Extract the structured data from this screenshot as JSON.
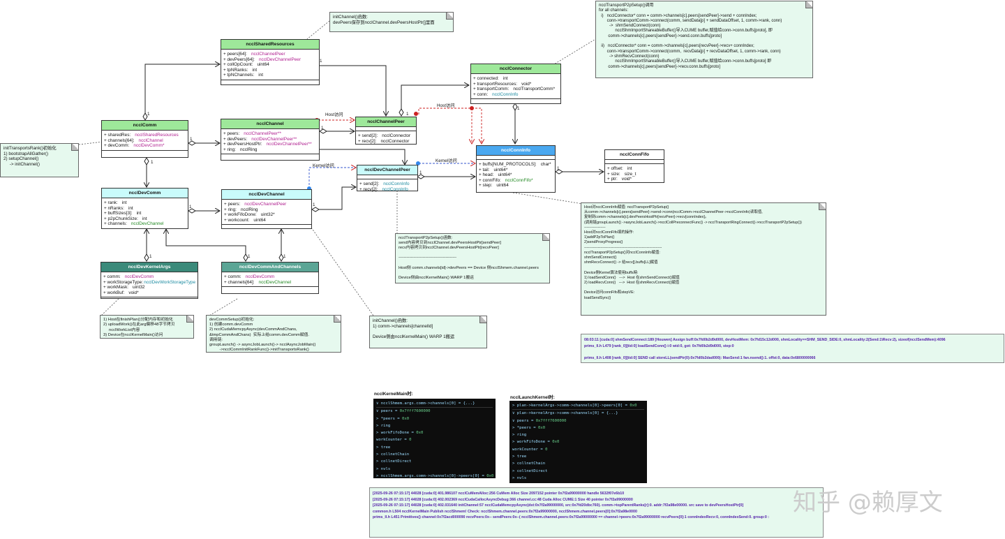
{
  "classes": {
    "sharedResources": {
      "title": "ncclSharedResources",
      "fields": [
        {
          "name": "+ peers[64]:",
          "type": "ncclChannelPeer",
          "tc": "mag"
        },
        {
          "name": "+ devPeers[64]:",
          "type": "ncclDevChannelPeer",
          "tc": "mag"
        },
        {
          "name": "+ collOpCount:",
          "type": "uint64"
        },
        {
          "name": "+ tpNRanks:",
          "type": "int"
        },
        {
          "name": "+ tpNChannels:",
          "type": "int"
        }
      ]
    },
    "comm": {
      "title": "ncclComm",
      "fields": [
        {
          "name": "+ sharedRes:",
          "type": "ncclSharedResources",
          "tc": "mag"
        },
        {
          "name": "+ channels[64]:",
          "type": "ncclChannel",
          "tc": "mag"
        },
        {
          "name": "+ devComm:",
          "type": "ncclDevComm*",
          "tc": "mag"
        }
      ]
    },
    "channel": {
      "title": "ncclChannel",
      "fields": [
        {
          "name": "+ peers:",
          "type": "ncclChannelPeer**",
          "tc": "mag"
        },
        {
          "name": "+ devPeers:",
          "type": "ncclDevChannelPeer**",
          "tc": "mag"
        },
        {
          "name": "+ devPeersHostPtr:",
          "type": "ncclDevChannelPeer**",
          "tc": "mag"
        },
        {
          "name": "+ ring:",
          "type": "ncclRing"
        }
      ]
    },
    "channelPeer": {
      "title": "ncclChannelPeer",
      "fields": [
        {
          "name": "+ send[2]:",
          "type": "ncclConnector"
        },
        {
          "name": "+ recv[2]:",
          "type": "ncclConnector"
        }
      ]
    },
    "connector": {
      "title": "ncclConnector",
      "fields": [
        {
          "name": "+ connected:",
          "type": "int"
        },
        {
          "name": "+ transportResources:",
          "type": "void*"
        },
        {
          "name": "+ transportComm:",
          "type": "ncclTransportComm*"
        },
        {
          "name": "+ conn:",
          "type": "ncclConnInfo",
          "tc": "cy"
        }
      ]
    },
    "connInfo": {
      "title": "ncclConnInfo",
      "fields": [
        {
          "name": "+ buffs[NUM_PROTOCOLS]:",
          "type": "char*"
        },
        {
          "name": "+ tail:",
          "type": "uint64*"
        },
        {
          "name": "+ head:",
          "type": "uint64*"
        },
        {
          "name": "+ connFifo:",
          "type": "ncclConnFifo*",
          "tc": "gr"
        },
        {
          "name": "+ step:",
          "type": "uint64"
        }
      ]
    },
    "connFifo": {
      "title": "ncclConnFifo",
      "fields": [
        {
          "name": "+ offset:",
          "type": "int"
        },
        {
          "name": "+ size:",
          "type": "size_t"
        },
        {
          "name": "+ ptr:",
          "type": "void*"
        }
      ]
    },
    "devChannelPeer": {
      "title": "ncclDevChannelPeer",
      "fields": [
        {
          "name": "+ send[2]:",
          "type": "ncclConnInfo",
          "tc": "cy"
        },
        {
          "name": "+ recv[2]:",
          "type": "ncclConnInfo",
          "tc": "cy"
        }
      ]
    },
    "devComm": {
      "title": "ncclDevComm",
      "fields": [
        {
          "name": "+ rank:",
          "type": "int"
        },
        {
          "name": "+ nRanks:",
          "type": "int"
        },
        {
          "name": "+ buffSizes[3]:",
          "type": "int"
        },
        {
          "name": "+ p2pChunkSize:",
          "type": "int"
        },
        {
          "name": "+ channels:",
          "type": "ncclDevChannel",
          "tc": "gr"
        }
      ]
    },
    "devChannel": {
      "title": "ncclDevChannel",
      "fields": [
        {
          "name": "+ peers:",
          "type": "ncclDevChannelPeer",
          "tc": "mag"
        },
        {
          "name": "+ ring:",
          "type": "ncclRing"
        },
        {
          "name": "+ workFifoDone:",
          "type": "uint32*"
        },
        {
          "name": "+ workcount:",
          "type": "uint64"
        }
      ]
    },
    "devKernelArgs": {
      "title": "ncclDevKernelArgs",
      "fields": [
        {
          "name": "+ comm:",
          "type": "ncclDevComm",
          "tc": "mag"
        },
        {
          "name": "+ workStorageType:",
          "type": "ncclDevWorkStorageType",
          "tc": "cy"
        },
        {
          "name": "+ workMask:",
          "type": "uint32"
        },
        {
          "name": "+ workBuf:",
          "type": "void*"
        }
      ]
    },
    "devCommAndChannels": {
      "title": "ncclDevCommAndChannels",
      "fields": [
        {
          "name": "+ comm:",
          "type": "ncclDevComm",
          "tc": "mag"
        },
        {
          "name": "+ channels[64]:",
          "type": "ncclDevChannel",
          "tc": "gr"
        }
      ]
    }
  },
  "labels": {
    "host1": "Host访问",
    "host2": "Host访问",
    "kernel1": "Kernel访问",
    "kernel2": "Kernel访问",
    "m1": "1",
    "m2": "1",
    "m3": "1",
    "m4": "1",
    "m5": "1",
    "m6": "1",
    "m7": "1",
    "m8": "1",
    "m9": "1",
    "m10": "1",
    "m11": "1",
    "m12": "1",
    "m13": "1",
    "m14": "1"
  },
  "notes": {
    "initChannelTop": "initChannel()函数:\ndevPeers保存到ncclChannel.devPeersHostPtr[]里面",
    "p2pSetupTop": "ncclTransportP2pSetup()调用\nfor all channels:\n  i)   ncclConnector* conn = comm->channels[c].peers[sendPeer]->send + connIndex;\n       conn->transportComm->connect(comm, sendData[p] + sendDataOffset, 1, comm->rank, conn)\n         ->  shmSendConnect(conn)\n              ncclShmImportShareableBuffer()导入CUME buffer,赋值给conn->conn.buffs[proto], 即\n        comm->channels[c].peers[sendPeer]->send.conn.buffs[proto]\n\n  ii)   ncclConnector* conn = comm->channels[c].peers[recvPeer]->recv+ connIndex;\n       conn->transportComm->connect(comm,  recvData[p] + recvDataOffset, 1, comm->rank, conn)\n         -> shmRecvConnect(conn)\n              ncclShmImportShareableBuffer()导入CUME buffer,赋值给conn->conn.buffs[proto] 即\n        comm->channels[c].peers[sendPeer]->recv.conn.buffs[proto]",
    "initTransportsRank": "initTransportsRank()初始化\n1) bootstrapAllGather()\n2) setupChannel()\n     -> initChannel()",
    "p2pSetupMid": "ncclTransportP2pSetup()函数:\nsend内容拷贝到ncclChannel.devPeersHostPtr[sendPeer]\nrecv内容拷贝到ncclChannel.devPeersHostPtr[recvPeer]\n\n-------------------------------------------\n\nHost侧 comm.channels[id]->devPeers == Device 侧ncclShmem.channel.peers\n\nDevice侧由ncclKernelMain() WARP 1搬运",
    "connInfoSide": "Host对ncclConnInfo赋值: ncclTransportP2pSetup()\n从comm->channels[c].peers[sendPeer]->send->conn(ncclComm->ncclChannelPeer->ncclConnInfo)读取值,\n复制到comm->channels[c].devPeersHostPtr[recvPeer]->recv[connIndex]。\n(调用链groupLaunch() ->asyncJobLaunch()->ncclCollPreconnectFunc() -> ncclTransportRingConnect()->ncclTransportP2pSetup())\n-----------------\nHost对ncclConnFifo填的操作:\n1)addP2pToPlan()\n2)sendProxyProgress()\n--------------------------------------------------------------\nncclTransportP2pSetup()对ncclConnInfo赋值:\nshmSendConnect()\nshmRecvConnect() -> 给recv[].buffs[LL]赋值\n\nDevice侧Kernel算法使用buffs時:\n1) loadSendConn()   --->  Host 在shmSendConnect()赋值\n2) loadRecvConn()   --->  Host 在shmRecvConnect()赋值\n\nDevice访问connFifo和stepVE:\nloadSendSync()",
    "hostFinishPlan": "1) Host在finishPlan()分配内存和初始化\n2) uploadWork()在此arg偏移48字节拷贝\n     ncclWorkList内容\n3) Device在ncclKernelMain()访问",
    "devCommSetup": "devCommSetup()初始化:\n1) 创建comm.devComm\n2) ncclCudaMemcpyAsync(devCommAndChans,\n&tmpCommAndChans)  实际上给comm.devComm赋值.\n调用链:\ngroupLaunch() -> asyncJobLaunch()-> ncclAsyncJobMain()\n         ->ncclCommInitRankFunc()->initTransportsRank()",
    "initChannelBottom": "initChannel()函数:\n1) comm->channels[channelId]\n\nDevice侧由ncclKernelMain() WARP 1搬运"
  },
  "logs": {
    "shmLog": [
      "08:03:11 [cuda:0] shmSendConnect:189 [Houwen] Assign buff:0x7fd0b2d9d000, devHostMem: 0x7fd15c12d000, shmLocality==SHM_SEND_SIDE:0, shmLocality:2(Send:1\\Recv:2), sizeof(ncclSendMem):4096",
      "   prims_ll.h L479 [rank_0][tid:0] loadSendConn() i:0 wid:0, got:  0x7fd0b2d9d000, step:0",
      "",
      "   prims_ll.h L408 [rank_0][tid:0]  SEND call storeLL(sendPtr(0):0x7fd0b2dad000): MaxSend:1 fan.nsend():1. offst:0, data:0x6800000066"
    ],
    "bottomLog": [
      "[2025-09-26 07:15:17] 44028 [cuda:0] 401.986107 ncclCuMemAlloc:256 CuMem Alloc Size 2097152 pointer 0x7f2a99000000 handle 5632f07e6b10",
      "[2025-09-26 07:15:17] 44028 [cuda:0] 402.002369 ncclCudaCallocAsyncDebug:366 channel.cc:48 Cuda Alloc CUME:1 Size 40 pointer 0x7f2a99000000",
      "[2025-09-26 07:15:17] 44028 [cuda:0] 402.031640 initChannel:57 ncclCudaMemcpyAsync(dst:0x7f2a99000000, src:0x7fd20dbc760). comm->topParentRanks[r]:0.  addr:7f2a98e00000. src save to devPeersHostPtr[0]",
      "common.h L504 ncclKernelMain   Publish ncclShmem! Check: ncclShmem.channel.peers:0x7f2a99000000, ncclShmem.channel.peers[0]:0x7f2a98e0000",
      "prims_ll.h L451 Primitives()  channel:0x7f2acd000090 recvPeers:0x-- sendPeers:0x--( ncclShmem.channel.peers:0x7f2a99000000 == channel->peers:0x7f2a99000000   recvPeers[0]:1 connIndexRecv:0, connIndexSend:0. group:0 :"
    ]
  },
  "terminals": {
    "kernelMain": {
      "caption": "ncclKernelMain时:",
      "rows": [
        {
          "t": "∨ ncclShmem.args.comm->channels[0] = {...}",
          "cls": "top"
        },
        {
          "t": "  ∨ peers = ",
          "v": "0x7fff7600000"
        },
        {
          "t": "    > *peers = ",
          "v": "0x0"
        },
        {
          "t": "  > ring"
        },
        {
          "t": "  > workFifoDone = ",
          "v": "0x0"
        },
        {
          "t": "    workCounter = ",
          "v": "0"
        },
        {
          "t": "  > tree"
        },
        {
          "t": "  > collnetChain"
        },
        {
          "t": "  > collnetDirect"
        },
        {
          "t": "  > nvls"
        },
        {
          "t": "> ncclShmem.args.comm->channels[0]->peers[0] = ",
          "v": "0x0"
        }
      ]
    },
    "launchKernel": {
      "caption": "ncclLaunchKernel时:",
      "rows": [
        {
          "t": "> plan->kernelArgs->comm->channels[0]->peers[0] = ",
          "v": "0x0",
          "cls": "top"
        },
        {
          "t": "∨ plan->kernelArgs->comm->channels[0] = {...}"
        },
        {
          "t": "  ∨ peers = ",
          "v": "0x7fff7600000"
        },
        {
          "t": "    > *peers = ",
          "v": "0x0"
        },
        {
          "t": "  > ring"
        },
        {
          "t": "  > workFifoDone = ",
          "v": "0x0"
        },
        {
          "t": "    workCounter = ",
          "v": "0"
        },
        {
          "t": "  > tree"
        },
        {
          "t": "  > collnetChain"
        },
        {
          "t": "  > collnetDirect"
        },
        {
          "t": "  > nvls"
        }
      ]
    }
  },
  "watermark": "知乎 @赖厚文"
}
